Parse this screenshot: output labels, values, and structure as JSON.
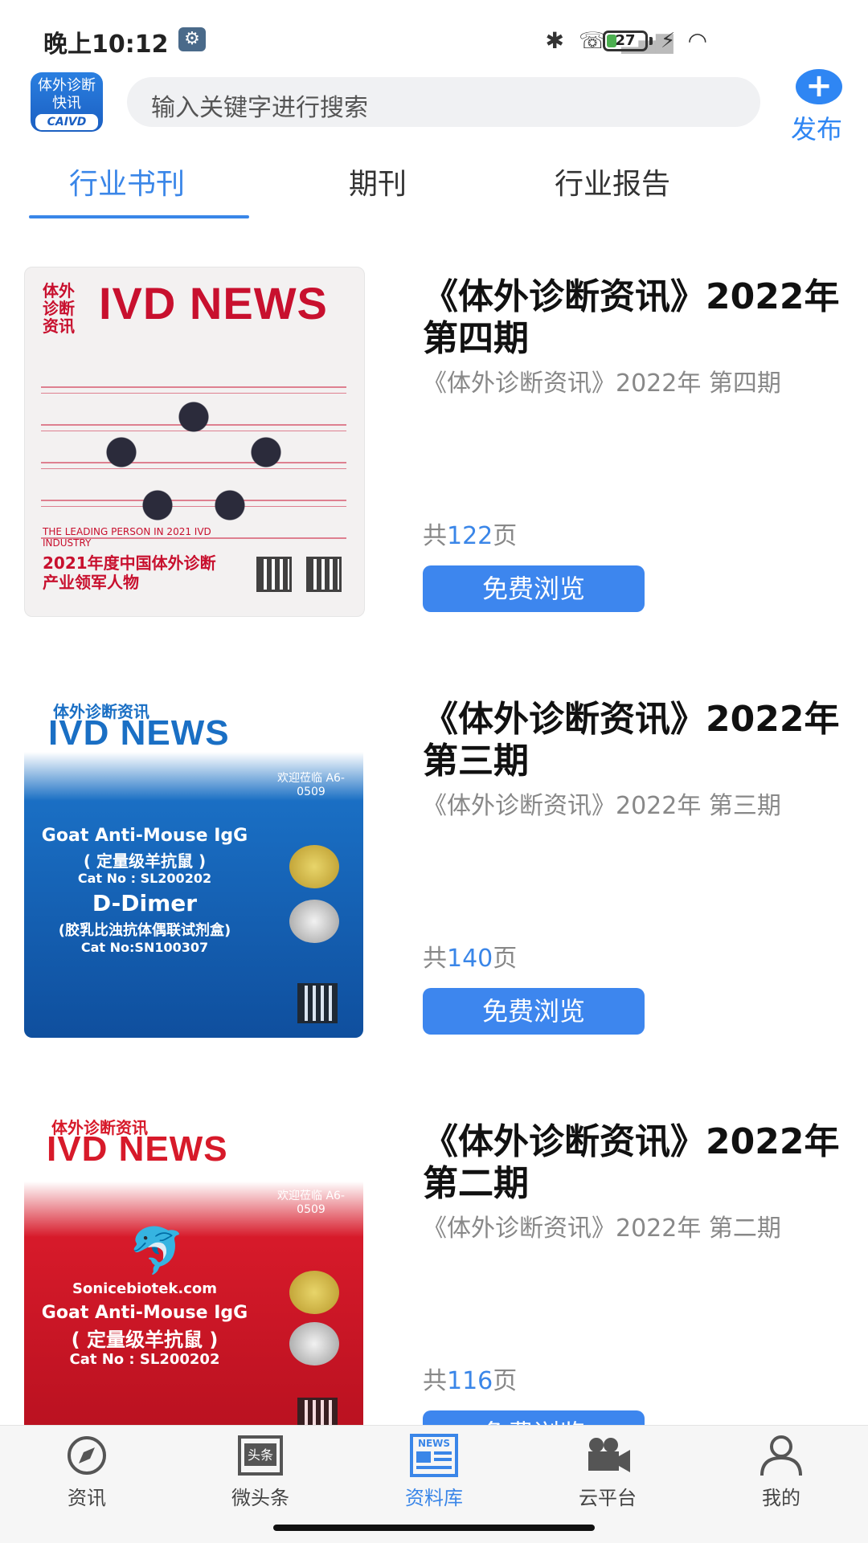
{
  "status_bar": {
    "time": "晚上10:12",
    "battery": "27",
    "battery_level": 0.27
  },
  "header": {
    "logo": {
      "line1": "体外诊断",
      "line2": "快讯",
      "line3": "CAIVD"
    },
    "search_placeholder": "输入关键字进行搜索",
    "publish_label": "发布"
  },
  "tabs": [
    {
      "label": "行业书刊",
      "active": true
    },
    {
      "label": "期刊",
      "active": false
    },
    {
      "label": "行业报告",
      "active": false
    }
  ],
  "items": [
    {
      "title": "《体外诊断资讯》2022年 第四期",
      "subtitle": "《体外诊断资讯》2022年 第四期",
      "pages_prefix": "共",
      "pages": "122",
      "pages_suffix": "页",
      "button": "免费浏览",
      "cover": {
        "small": "体外 诊断 资讯",
        "big": "IVD NEWS",
        "line_a": "THE LEADING PERSON IN 2021 IVD INDUSTRY",
        "line_b": "2021年度中国体外诊断",
        "line_c": "产业领军人物"
      }
    },
    {
      "title": "《体外诊断资讯》2022年 第三期",
      "subtitle": "《体外诊断资讯》2022年 第三期",
      "pages_prefix": "共",
      "pages": "140",
      "pages_suffix": "页",
      "button": "免费浏览",
      "cover": {
        "small": "体外诊断资讯",
        "big": "IVD NEWS",
        "line_a": "Goat Anti-Mouse IgG",
        "line_b": "( 定量级羊抗鼠 )",
        "line_c": "Cat No : SL200202",
        "line_d": "D-Dimer",
        "line_e": "(胶乳比浊抗体偶联试剂盒)",
        "line_f": "Cat No:SN100307",
        "welcome": "欢迎莅临 A6-0509"
      }
    },
    {
      "title": "《体外诊断资讯》2022年 第二期",
      "subtitle": "《体外诊断资讯》2022年 第二期",
      "pages_prefix": "共",
      "pages": "116",
      "pages_suffix": "页",
      "button": "免费浏览",
      "cover": {
        "small": "体外诊断资讯",
        "big": "IVD NEWS",
        "line_a": "Sonicebiotek.com",
        "line_b": "Goat Anti-Mouse IgG",
        "line_c": "( 定量级羊抗鼠 )",
        "line_d": "Cat No : SL200202",
        "welcome": "欢迎莅临 A6-0509"
      }
    }
  ],
  "bottom_nav": [
    {
      "label": "资讯",
      "icon": "compass-icon",
      "active": false
    },
    {
      "label": "微头条",
      "icon": "headline-icon",
      "active": false
    },
    {
      "label": "资料库",
      "icon": "news-icon",
      "active": true
    },
    {
      "label": "云平台",
      "icon": "camera-icon",
      "active": false
    },
    {
      "label": "我的",
      "icon": "user-icon",
      "active": false
    }
  ],
  "colors": {
    "accent": "#3a86e8",
    "button": "#3d86ee",
    "cover1_red": "#c8102e",
    "cover2_blue": "#1a6fc4",
    "cover3_red": "#d71a2a"
  }
}
